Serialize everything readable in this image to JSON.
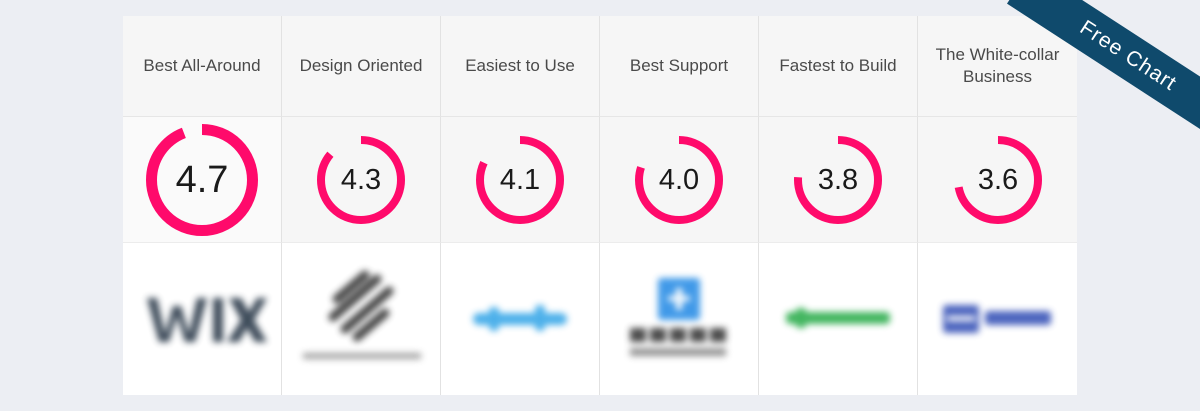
{
  "ribbon": {
    "label": "Free Chart"
  },
  "accent_color": "#ff0a6b",
  "columns": [
    {
      "heading": "Best All-Around",
      "score": "4.7",
      "score_value": 4.7,
      "logo_icon": "wix-logo-icon"
    },
    {
      "heading": "Design Oriented",
      "score": "4.3",
      "score_value": 4.3,
      "logo_icon": "squarespace-logo-icon"
    },
    {
      "heading": "Easiest to Use",
      "score": "4.1",
      "score_value": 4.1,
      "logo_icon": "weebly-logo-icon"
    },
    {
      "heading": "Best Support",
      "score": "4.0",
      "score_value": 4.0,
      "logo_icon": "site123-logo-icon"
    },
    {
      "heading": "Fastest to Build",
      "score": "3.8",
      "score_value": 3.8,
      "logo_icon": "hostinger-logo-icon"
    },
    {
      "heading": "The White-collar Business",
      "score": "3.6",
      "score_value": 3.6,
      "logo_icon": "godaddy-logo-icon"
    }
  ]
}
